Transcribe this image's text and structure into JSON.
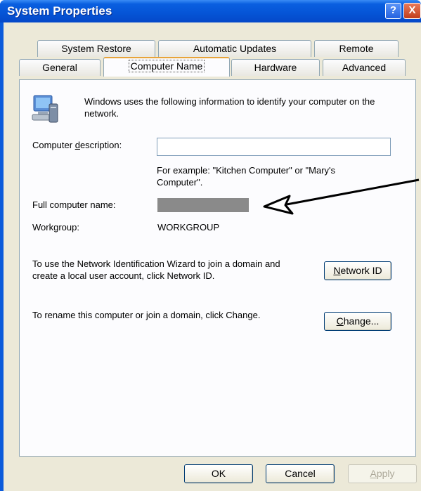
{
  "window": {
    "title": "System Properties",
    "help_label": "?",
    "close_label": "X"
  },
  "tabs": {
    "row1": [
      "System Restore",
      "Automatic Updates",
      "Remote"
    ],
    "row2": [
      "General",
      "Computer Name",
      "Hardware",
      "Advanced"
    ],
    "active": "Computer Name"
  },
  "panel": {
    "intro": "Windows uses the following information to identify your computer on the network.",
    "description_label_pre": "Computer ",
    "description_label_ul": "d",
    "description_label_post": "escription:",
    "description_value": "",
    "example_text": "For example: \"Kitchen Computer\" or \"Mary's Computer\".",
    "full_name_label": "Full computer name:",
    "workgroup_label": "Workgroup:",
    "workgroup_value": "WORKGROUP",
    "network_id_text": "To use the Network Identification Wizard to join a domain and create a local user account, click Network ID.",
    "network_id_button_ul": "N",
    "network_id_button_rest": "etwork ID",
    "rename_text": "To rename this computer or join a domain, click Change.",
    "change_button_ul": "C",
    "change_button_rest": "hange..."
  },
  "footer": {
    "ok_label": "OK",
    "cancel_label": "Cancel",
    "apply_label_ul": "A",
    "apply_label_rest": "pply"
  },
  "colors": {
    "titlebar": "#0554d6",
    "client_bg": "#ece9d8",
    "panel_bg": "#fcfcfe",
    "annotation_arrow": "#000000"
  }
}
